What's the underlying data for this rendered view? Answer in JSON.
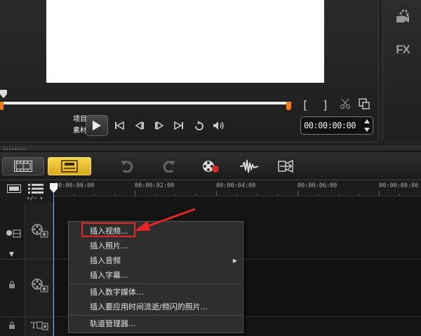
{
  "player": {
    "mode_project": "项目",
    "mode_clip": "素材",
    "timecode": "00:00:00:00",
    "bracket_in": "[",
    "bracket_out": "]"
  },
  "right_tools": {
    "fx_label": "FX"
  },
  "timeline": {
    "ruler_labels": [
      "00:00:00:00",
      "00:00:02:00",
      "00:00:04:00",
      "00:00:06:00",
      "00:00:08:00"
    ],
    "zoom_control": "+/−"
  },
  "context_menu": {
    "items": [
      {
        "label": "插入视频..."
      },
      {
        "label": "插入照片..."
      },
      {
        "label": "插入音频"
      },
      {
        "label": "插入字幕..."
      },
      {
        "label": "插入数字媒体..."
      },
      {
        "label": "插入要应用时间流逝/频闪的照片..."
      },
      {
        "label": "轨道管理器..."
      }
    ]
  },
  "colors": {
    "accent_orange": "#ef7d1d",
    "highlight_red": "#e32626",
    "storyboard_yellow": "#f0c530"
  }
}
